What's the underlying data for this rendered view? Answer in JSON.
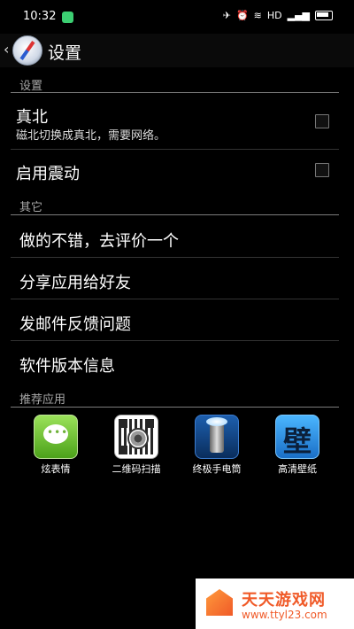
{
  "status_bar": {
    "time": "10:32",
    "right_text": "HD"
  },
  "action_bar": {
    "title": "设置"
  },
  "sections": {
    "settings_header": "设置",
    "other_header": "其它",
    "recommended_header": "推荐应用"
  },
  "settings_items": [
    {
      "title": "真北",
      "subtitle": "磁北切换成真北，需要网络。",
      "checked": false
    },
    {
      "title": "启用震动",
      "checked": false
    }
  ],
  "other_items": [
    {
      "title": "做的不错，去评价一个"
    },
    {
      "title": "分享应用给好友"
    },
    {
      "title": "发邮件反馈问题"
    },
    {
      "title": "软件版本信息"
    }
  ],
  "recommended_apps": [
    {
      "label": "炫表情",
      "icon": "chat-bubble-icon",
      "color": "#5cb82a"
    },
    {
      "label": "二维码扫描",
      "icon": "qr-scan-icon",
      "color": "#ffffff"
    },
    {
      "label": "终极手电筒",
      "icon": "flashlight-icon",
      "color": "#1d5fae"
    },
    {
      "label": "高清壁纸",
      "icon": "wallpaper-icon",
      "color": "#2a8ee6"
    }
  ],
  "watermark": {
    "brand": "天天游戏网",
    "url": "www.ttyl23.com"
  },
  "colors": {
    "background": "#000000",
    "divider_section": "#7c7c7c",
    "divider_item": "#333333",
    "watermark_orange": "#f05a28"
  }
}
